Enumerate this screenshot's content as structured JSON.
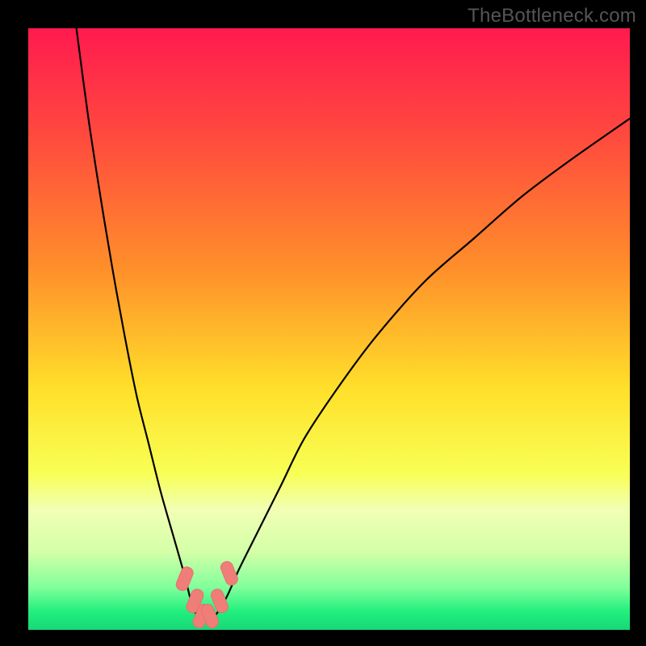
{
  "watermark": {
    "text": "TheBottleneck.com"
  },
  "colors": {
    "gradient_stops": [
      {
        "offset": 0.0,
        "color": "#ff1a4f"
      },
      {
        "offset": 0.18,
        "color": "#ff4a3e"
      },
      {
        "offset": 0.4,
        "color": "#ff8f2a"
      },
      {
        "offset": 0.6,
        "color": "#ffe02a"
      },
      {
        "offset": 0.74,
        "color": "#f8ff55"
      },
      {
        "offset": 0.8,
        "color": "#f1ffb4"
      },
      {
        "offset": 0.87,
        "color": "#d4ffa8"
      },
      {
        "offset": 0.93,
        "color": "#7fff9a"
      },
      {
        "offset": 0.97,
        "color": "#20ef7e"
      },
      {
        "offset": 1.0,
        "color": "#17d977"
      }
    ],
    "curve_stroke": "#000000",
    "marker_fill": "#ef7d78",
    "marker_stroke": "#e7726d"
  },
  "chart_data": {
    "type": "line",
    "title": "",
    "xlabel": "",
    "ylabel": "",
    "xlim": [
      0,
      100
    ],
    "ylim": [
      0,
      100
    ],
    "grid": false,
    "legend": false,
    "note": "Values are estimated from pixel positions; no axis ticks are shown in the image.",
    "series": [
      {
        "name": "bottleneck-curve",
        "x": [
          8,
          10,
          12,
          14,
          16,
          18,
          20,
          22,
          24,
          26,
          27,
          28,
          29.5,
          31,
          33,
          35,
          38,
          42,
          46,
          52,
          58,
          66,
          74,
          82,
          90,
          100
        ],
        "y": [
          100,
          85,
          72,
          60,
          49,
          39,
          31,
          23,
          16,
          9,
          5,
          2.5,
          1.5,
          2.3,
          5.5,
          10,
          16,
          24,
          32,
          41,
          49,
          58,
          65,
          72,
          78,
          85
        ]
      }
    ],
    "markers": [
      {
        "x": 26.0,
        "y": 8.5
      },
      {
        "x": 27.7,
        "y": 4.8
      },
      {
        "x": 28.8,
        "y": 2.3
      },
      {
        "x": 30.2,
        "y": 2.3
      },
      {
        "x": 31.8,
        "y": 4.8
      },
      {
        "x": 33.4,
        "y": 9.4
      }
    ]
  }
}
